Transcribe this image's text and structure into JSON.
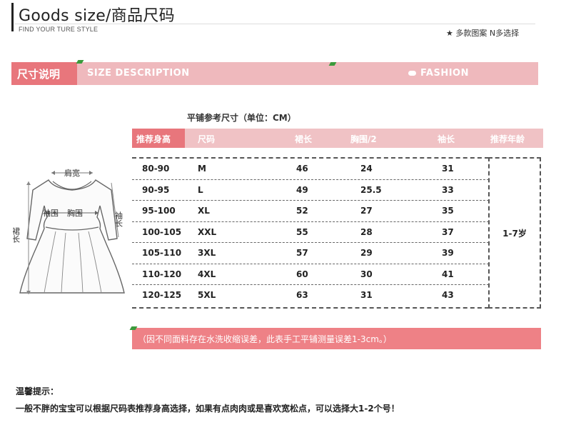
{
  "header": {
    "title": "Goods size/商品尺码",
    "subtitle": "FIND YOUR TURE STYLE",
    "options_note": "★ 多款图案  N多选择"
  },
  "banner": {
    "left_label": "尺寸说明",
    "en_label": "SIZE  DESCRIPTION",
    "fashion_label": "FASHION"
  },
  "table": {
    "caption": "平铺参考尺寸（单位：CM）",
    "headers": [
      "推荐身高",
      "尺码",
      "裙长",
      "胸围/2",
      "袖长",
      "推荐年龄"
    ],
    "rows": [
      {
        "height": "80-90",
        "size": "M",
        "length": "46",
        "bust": "24",
        "sleeve": "31"
      },
      {
        "height": "90-95",
        "size": "L",
        "length": "49",
        "bust": "25.5",
        "sleeve": "33"
      },
      {
        "height": "95-100",
        "size": "XL",
        "length": "52",
        "bust": "27",
        "sleeve": "35"
      },
      {
        "height": "100-105",
        "size": "XXL",
        "length": "55",
        "bust": "28",
        "sleeve": "37"
      },
      {
        "height": "105-110",
        "size": "3XL",
        "length": "57",
        "bust": "29",
        "sleeve": "39"
      },
      {
        "height": "110-120",
        "size": "4XL",
        "length": "60",
        "bust": "30",
        "sleeve": "41"
      },
      {
        "height": "120-125",
        "size": "5XL",
        "length": "63",
        "bust": "31",
        "sleeve": "43"
      }
    ],
    "age": "1-7岁"
  },
  "illustration": {
    "shoulder_label": "肩宽",
    "cuff_label": "袖围",
    "bust_label": "胸围",
    "sleeve_label": "袖长",
    "length_label": "裙长"
  },
  "note": "（因不同面料存在水洗收缩误差，此表手工平铺测量误差1-3cm。）",
  "tips": {
    "title": "温馨提示：",
    "body": "一般不胖的宝宝可以根据尺码表推荐身高选择，如果有点肉肉或是喜欢宽松点，可以选择大1-2个号！"
  }
}
